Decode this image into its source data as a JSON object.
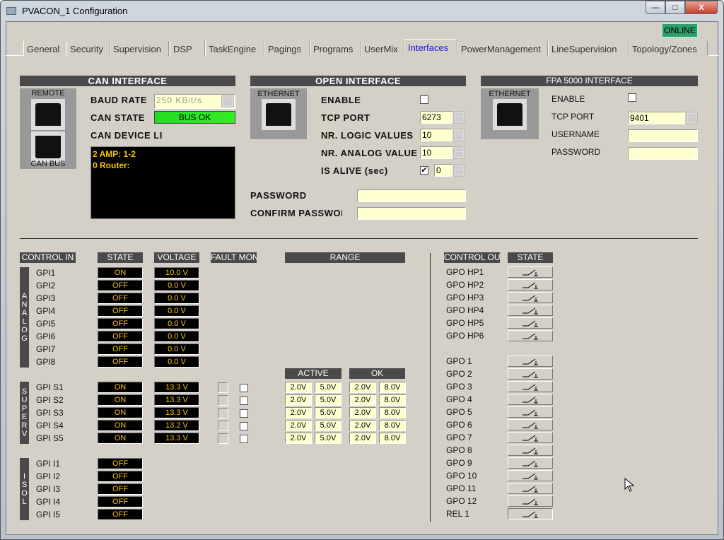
{
  "window": {
    "title": "PVACON_1 Configuration",
    "min": "—",
    "max": "□",
    "close": "X"
  },
  "status": {
    "label": "ONLINE",
    "color": "#2e9e6a"
  },
  "tabs": [
    "General",
    "Security",
    "Supervision",
    "DSP",
    "TaskEngine",
    "Pagings",
    "Programs",
    "UserMix",
    "Interfaces",
    "PowerManagement",
    "LineSupervision",
    "Topology/Zones"
  ],
  "selected_tab": "Interfaces",
  "can": {
    "title": "CAN INTERFACE",
    "remote": "REMOTE",
    "canbus": "CAN BUS",
    "baud_label": "BAUD RATE",
    "baud_value": "250 KBit/s",
    "state_label": "CAN STATE",
    "state_value": "BUS OK",
    "state_color": "#33ee22",
    "device_label": "CAN DEVICE LI",
    "devices": [
      "2 AMP: 1-2",
      "0 Router:"
    ]
  },
  "open": {
    "title": "OPEN INTERFACE",
    "ethernet": "ETHERNET",
    "enable_label": "ENABLE",
    "enable": false,
    "tcp_label": "TCP PORT",
    "tcp": "6273",
    "logic_label": "NR. LOGIC VALUES",
    "logic": "10",
    "analog_label": "NR. ANALOG VALUE",
    "analog": "10",
    "alive_label": "IS ALIVE (sec)",
    "alive_checked": true,
    "alive": "0",
    "password_label": "PASSWORD",
    "password": "",
    "confirm_label": "CONFIRM PASSWOR",
    "confirm": ""
  },
  "fpa": {
    "title": "FPA 5000 INTERFACE",
    "ethernet": "ETHERNET",
    "enable_label": "ENABLE",
    "enable": false,
    "tcp_label": "TCP PORT",
    "tcp": "9401",
    "username_label": "USERNAME",
    "username": "",
    "password_label": "PASSWORD",
    "password": ""
  },
  "headers": {
    "control_in": "CONTROL IN",
    "state": "STATE",
    "voltage": "VOLTAGE",
    "fault_mon": "FAULT MON",
    "range": "RANGE",
    "active": "ACTIVE",
    "ok": "OK",
    "control_out": "CONTROL OUT",
    "out_state": "STATE"
  },
  "groups": {
    "analog": "ANALOG",
    "superv": "SUPERV",
    "isol": "ISOL"
  },
  "analog": [
    {
      "name": "GPI1",
      "state": "ON",
      "voltage": "10.0 V"
    },
    {
      "name": "GPI2",
      "state": "OFF",
      "voltage": "0.0 V"
    },
    {
      "name": "GPI3",
      "state": "OFF",
      "voltage": "0.0 V"
    },
    {
      "name": "GPI4",
      "state": "OFF",
      "voltage": "0.0 V"
    },
    {
      "name": "GPI5",
      "state": "OFF",
      "voltage": "0.0 V"
    },
    {
      "name": "GPI6",
      "state": "OFF",
      "voltage": "0.0 V"
    },
    {
      "name": "GPI7",
      "state": "OFF",
      "voltage": "0.0 V"
    },
    {
      "name": "GPI8",
      "state": "OFF",
      "voltage": "0.0 V"
    }
  ],
  "superv": [
    {
      "name": "GPI S1",
      "state": "ON",
      "voltage": "13.3 V",
      "fault": false,
      "range": [
        "2.0V",
        "5.0V",
        "2.0V",
        "8.0V"
      ]
    },
    {
      "name": "GPI S2",
      "state": "ON",
      "voltage": "13.3 V",
      "fault": false,
      "range": [
        "2.0V",
        "5.0V",
        "2.0V",
        "8.0V"
      ]
    },
    {
      "name": "GPI S3",
      "state": "ON",
      "voltage": "13.3 V",
      "fault": false,
      "range": [
        "2.0V",
        "5.0V",
        "2.0V",
        "8.0V"
      ]
    },
    {
      "name": "GPI S4",
      "state": "ON",
      "voltage": "13.2 V",
      "fault": false,
      "range": [
        "2.0V",
        "5.0V",
        "2.0V",
        "8.0V"
      ]
    },
    {
      "name": "GPI S5",
      "state": "ON",
      "voltage": "13.3 V",
      "fault": false,
      "range": [
        "2.0V",
        "5.0V",
        "2.0V",
        "8.0V"
      ]
    }
  ],
  "isol": [
    {
      "name": "GPI I1",
      "state": "OFF"
    },
    {
      "name": "GPI I2",
      "state": "OFF"
    },
    {
      "name": "GPI I3",
      "state": "OFF"
    },
    {
      "name": "GPI I4",
      "state": "OFF"
    },
    {
      "name": "GPI I5",
      "state": "OFF"
    }
  ],
  "outputs_hp": [
    "GPO HP1",
    "GPO HP2",
    "GPO HP3",
    "GPO HP4",
    "GPO HP5",
    "GPO HP6"
  ],
  "outputs": [
    "GPO 1",
    "GPO 2",
    "GPO 3",
    "GPO 4",
    "GPO 5",
    "GPO 6",
    "GPO 7",
    "GPO 8",
    "GPO 9",
    "GPO 10",
    "GPO 11",
    "GPO 12",
    "REL 1"
  ]
}
